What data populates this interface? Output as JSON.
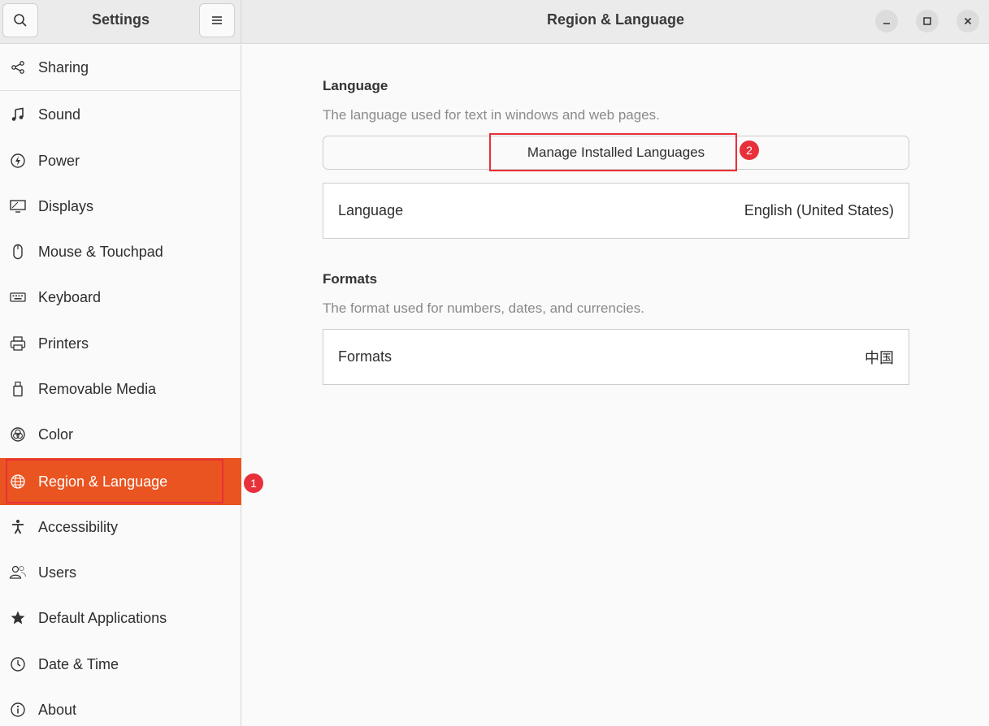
{
  "header": {
    "sidebar_title": "Settings",
    "main_title": "Region & Language"
  },
  "sidebar": {
    "items": [
      {
        "label": "Sharing",
        "icon": "share-icon"
      },
      {
        "label": "Sound",
        "icon": "music-note-icon"
      },
      {
        "label": "Power",
        "icon": "power-icon"
      },
      {
        "label": "Displays",
        "icon": "display-icon"
      },
      {
        "label": "Mouse & Touchpad",
        "icon": "mouse-icon"
      },
      {
        "label": "Keyboard",
        "icon": "keyboard-icon"
      },
      {
        "label": "Printers",
        "icon": "printer-icon"
      },
      {
        "label": "Removable Media",
        "icon": "usb-drive-icon"
      },
      {
        "label": "Color",
        "icon": "color-icon"
      },
      {
        "label": "Region & Language",
        "icon": "globe-icon",
        "active": true
      },
      {
        "label": "Accessibility",
        "icon": "accessibility-icon"
      },
      {
        "label": "Users",
        "icon": "users-icon"
      },
      {
        "label": "Default Applications",
        "icon": "star-icon"
      },
      {
        "label": "Date & Time",
        "icon": "clock-icon"
      },
      {
        "label": "About",
        "icon": "info-icon"
      }
    ]
  },
  "language_section": {
    "title": "Language",
    "description": "The language used for text in windows and web pages.",
    "manage_button": "Manage Installed Languages",
    "row_label": "Language",
    "row_value": "English (United States)"
  },
  "formats_section": {
    "title": "Formats",
    "description": "The format used for numbers, dates, and currencies.",
    "row_label": "Formats",
    "row_value": "中国"
  },
  "annotations": {
    "badge1": "1",
    "badge2": "2"
  },
  "colors": {
    "accent": "#e95420",
    "annotation": "#e8303a"
  }
}
